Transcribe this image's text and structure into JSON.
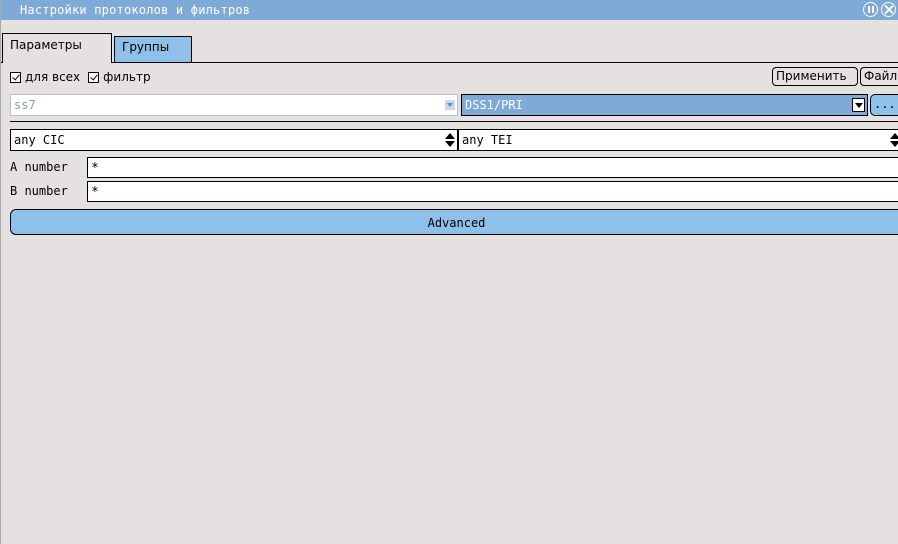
{
  "window": {
    "title": "Настройки протоколов и фильтров"
  },
  "tabs": [
    {
      "label": "Параметры",
      "active": true
    },
    {
      "label": "Группы",
      "active": false
    }
  ],
  "filters": {
    "for_all": {
      "label": "для всех",
      "checked": true
    },
    "filter": {
      "label": "фильтр",
      "checked": true
    }
  },
  "buttons": {
    "apply": "Применить",
    "file": "Файл",
    "browse": "...",
    "advanced": "Advanced"
  },
  "protocols": {
    "left_value": "ss7",
    "right_value": "DSS1/PRI"
  },
  "selectors": {
    "cic": "any CIC",
    "tei": "any TEI"
  },
  "numbers": {
    "a_label": "A number",
    "a_value": "*",
    "b_label": "B number",
    "b_value": "*"
  },
  "colors": {
    "titlebar": "#7fa9d6",
    "accent": "#8ec0ea",
    "window_bg": "#e6e1e1"
  },
  "icons": {
    "pause": "pause-icon",
    "close": "close-icon",
    "dropdown": "chevron-down-icon",
    "spinner": "up-down-arrows-icon"
  }
}
